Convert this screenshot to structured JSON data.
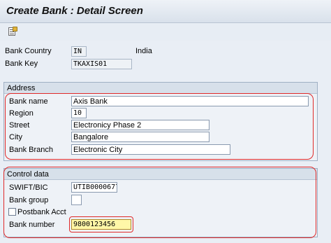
{
  "screen": {
    "title": "Create Bank : Detail Screen"
  },
  "toolbar": {
    "icons": [
      "document-icon"
    ]
  },
  "header_fields": {
    "bank_country": {
      "label": "Bank Country",
      "value": "IN",
      "description": "India"
    },
    "bank_key": {
      "label": "Bank Key",
      "value": "TKAXIS01"
    }
  },
  "address": {
    "title": "Address",
    "bank_name": {
      "label": "Bank name",
      "value": "Axis Bank"
    },
    "region": {
      "label": "Region",
      "value": "10"
    },
    "street": {
      "label": "Street",
      "value": "Electronicy Phase 2"
    },
    "city": {
      "label": "City",
      "value": "Bangalore"
    },
    "bank_branch": {
      "label": "Bank Branch",
      "value": "Electronic City"
    }
  },
  "control": {
    "title": "Control data",
    "swift": {
      "label": "SWIFT/BIC",
      "value": "UTIB0000677"
    },
    "bank_group": {
      "label": "Bank group",
      "value": ""
    },
    "postbank": {
      "label": "Postbank Acct",
      "checked": false
    },
    "bank_number": {
      "label": "Bank number",
      "value": "9800123456"
    }
  },
  "colors": {
    "highlight_outline": "#e02a2a",
    "active_field": "#fff7a8"
  }
}
